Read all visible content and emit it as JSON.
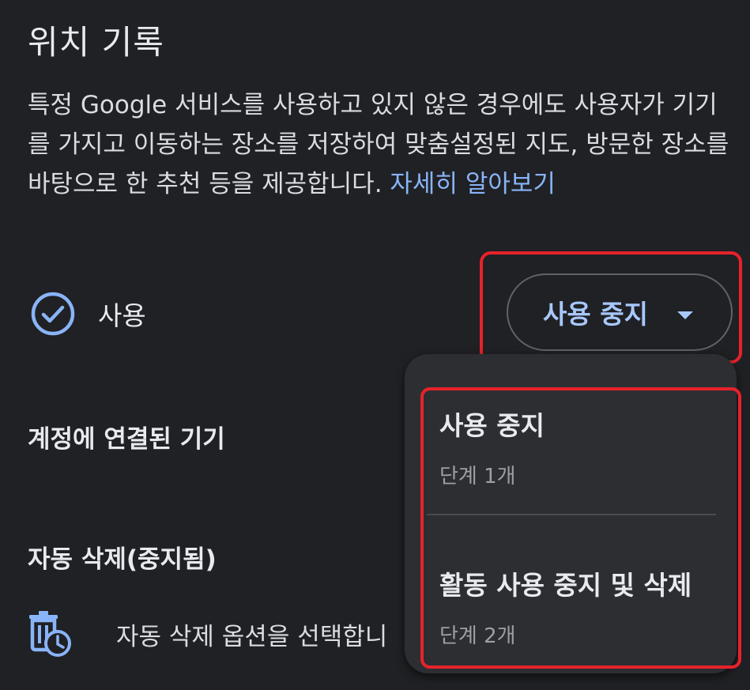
{
  "page": {
    "title": "위치 기록",
    "description": "특정 Google 서비스를 사용하고 있지 않은 경우에도 사용자가 기기를 가지고 이동하는 장소를 저장하여 맞춤설정된 지도, 방문한 장소를 바탕으로 한 추천 등을 제공합니다. ",
    "learn_more": "자세히 알아보기"
  },
  "status": {
    "icon": "check-circle-icon",
    "label": "사용"
  },
  "turn_off_button": {
    "label": "사용 중지",
    "icon": "caret-down-icon"
  },
  "sections": {
    "linked_devices": "계정에 연결된 기기",
    "auto_delete": "자동 삭제(중지됨)",
    "auto_delete_option": "자동 삭제 옵션을 선택합니",
    "auto_delete_icon": "trash-clock-icon"
  },
  "dropdown_menu": {
    "items": [
      {
        "title": "사용 중지",
        "subtitle": "단계 1개"
      },
      {
        "title": "활동 사용 중지 및 삭제",
        "subtitle": "단계 2개"
      }
    ]
  },
  "colors": {
    "background": "#202124",
    "accent": "#8ab4f8",
    "highlight": "#e8222b",
    "menu_background": "#2d2e31"
  }
}
